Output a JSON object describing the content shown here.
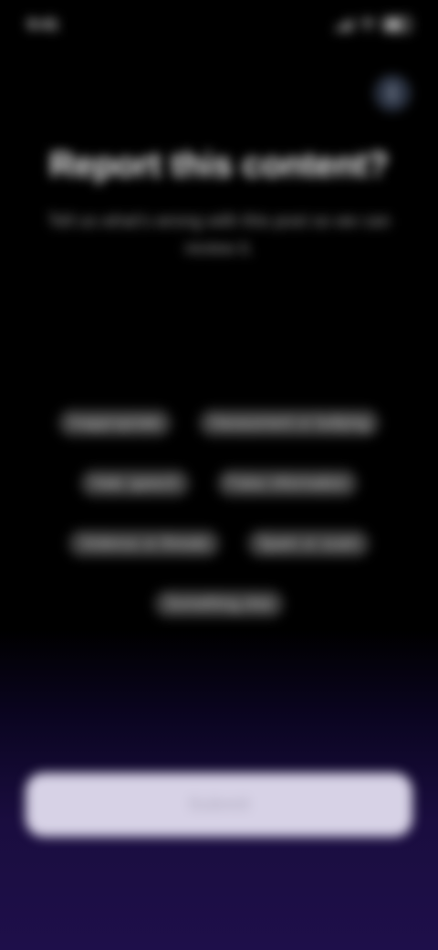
{
  "status_bar": {
    "time": "9:41",
    "signal_icon": "signal-icon",
    "wifi_icon": "wifi-icon",
    "battery_icon": "battery-icon"
  },
  "header": {
    "info_icon": "info-icon",
    "info_glyph": "i"
  },
  "report": {
    "title": "Report this content?",
    "subtitle": "Tell us what's wrong with this post so we can review it."
  },
  "reasons": [
    {
      "label": "Inappropriate"
    },
    {
      "label": "Harassment or bullying"
    },
    {
      "label": "Hate speech"
    },
    {
      "label": "False information"
    },
    {
      "label": "Violence or threats"
    },
    {
      "label": "Spam or scam"
    },
    {
      "label": "Something else"
    }
  ],
  "footer": {
    "submit_label": "Submit"
  },
  "colors": {
    "background_top": "#000000",
    "background_bottom": "#1e0f4a",
    "chip_bg": "#3a3a3a",
    "button_bg": "#d7d2e6"
  }
}
